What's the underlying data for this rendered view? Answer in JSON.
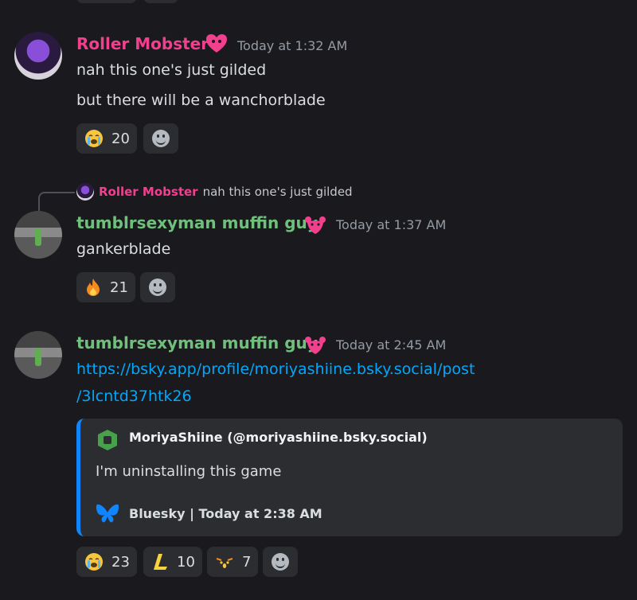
{
  "colors": {
    "background": "#1a1a1e",
    "name_pink": "#f23f8e",
    "name_green": "#6ec07a",
    "link": "#00a8fc",
    "embed_accent": "#1185fe"
  },
  "messages": [
    {
      "author": "Roller Mobster",
      "timestamp": "Today at 1:32 AM",
      "badge_icon": "pink-heart-icon",
      "lines": [
        "nah this one's just gilded",
        "but there will be a wanchorblade"
      ],
      "reactions": [
        {
          "emoji": "crying-face-icon",
          "count": "20"
        }
      ]
    },
    {
      "reply": {
        "author": "Roller Mobster",
        "text": "nah this one's just gilded"
      },
      "author": "tumblrsexyman muffin guy",
      "timestamp": "Today at 1:37 AM",
      "badge_icon": "pink-rat-icon",
      "lines": [
        "gankerblade"
      ],
      "reactions": [
        {
          "emoji": "fire-icon",
          "count": "21"
        }
      ]
    },
    {
      "author": "tumblrsexyman muffin guy",
      "timestamp": "Today at 2:45 AM",
      "badge_icon": "pink-rat-icon",
      "link_line1": "https://bsky.app/profile/moriyashiine.bsky.social/post",
      "link_line2": "/3lcntd37htk26",
      "embed": {
        "author": "MoriyaShiine (@moriyashiine.bsky.social)",
        "description": "I'm uninstalling this game",
        "footer": "Bluesky | Today at 2:38 AM"
      },
      "reactions": [
        {
          "emoji": "crying-face-icon",
          "count": "23"
        },
        {
          "emoji": "l-letter-icon",
          "count": "10"
        },
        {
          "emoji": "shocked-face-icon",
          "count": "7"
        }
      ]
    }
  ]
}
